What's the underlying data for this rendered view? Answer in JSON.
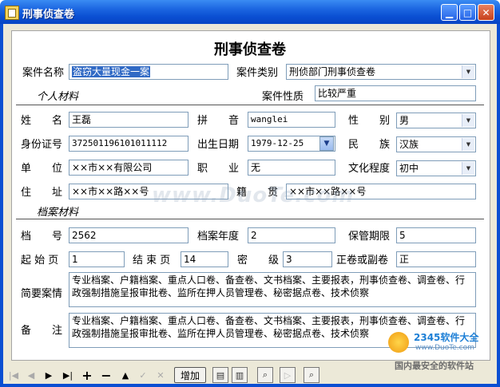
{
  "window": {
    "title": "刑事侦查卷"
  },
  "heading": "刑事侦查卷",
  "case": {
    "name_label": "案件名称",
    "name": "盗窃大量现金一案",
    "type_label": "案件类别",
    "type": "刑侦部门刑事侦查卷",
    "nature_label": "案件性质",
    "nature": "比较严重"
  },
  "personal": {
    "section": "个人材料",
    "name_label": "姓　　名",
    "name": "王磊",
    "pinyin_label": "拼　　音",
    "pinyin": "wanglei",
    "gender_label": "性　　别",
    "gender": "男",
    "id_label": "身份证号",
    "id": "372501196101011112",
    "dob_label": "出生日期",
    "dob": "1979-12-25",
    "ethnicity_label": "民　　族",
    "ethnicity": "汉族",
    "unit_label": "单　　位",
    "unit": "××市××有限公司",
    "job_label": "职　　业",
    "job": "无",
    "edu_label": "文化程度",
    "edu": "初中",
    "address_label": "住　　址",
    "address": "××市××路××号",
    "origin_label": "籍　　贯",
    "origin": "××市××路××号"
  },
  "archive": {
    "section": "档案材料",
    "no_label": "档　　号",
    "no": "2562",
    "year_label": "档案年度",
    "year": "2",
    "retention_label": "保管期限",
    "retention": "5",
    "start_label": "起 始 页",
    "start": "1",
    "end_label": "结 束 页",
    "end": "14",
    "secret_label": "密　　级",
    "secret": "3",
    "vol_label": "正卷或副卷",
    "vol": "正",
    "summary_label": "简要案情",
    "summary": "专业档案、户籍档案、重点人口卷、备查卷、文书档案、主要报表，刑事侦查卷、调查卷、行政强制措施呈报审批卷、监所在押人员管理卷、秘密据点卷、技术侦察",
    "remarks_label": "备　　注",
    "remarks": "专业档案、户籍档案、重点人口卷、备查卷、文书档案、主要报表，刑事侦查卷、调查卷、行政强制措施呈报审批卷、监所在押人员管理卷、秘密据点卷、技术侦察"
  },
  "toolbar": {
    "add": "增加",
    "nav_icons": [
      "first-icon",
      "prev-icon",
      "next-icon",
      "last-icon",
      "insert-icon",
      "delete-icon",
      "edit-icon",
      "post-icon",
      "cancel-icon"
    ]
  },
  "watermark": "www.DuoTe.com",
  "logo": {
    "text1": "2345软件大全",
    "text2": "www.DuoTe.com",
    "text3": "国内最安全的软件站"
  }
}
